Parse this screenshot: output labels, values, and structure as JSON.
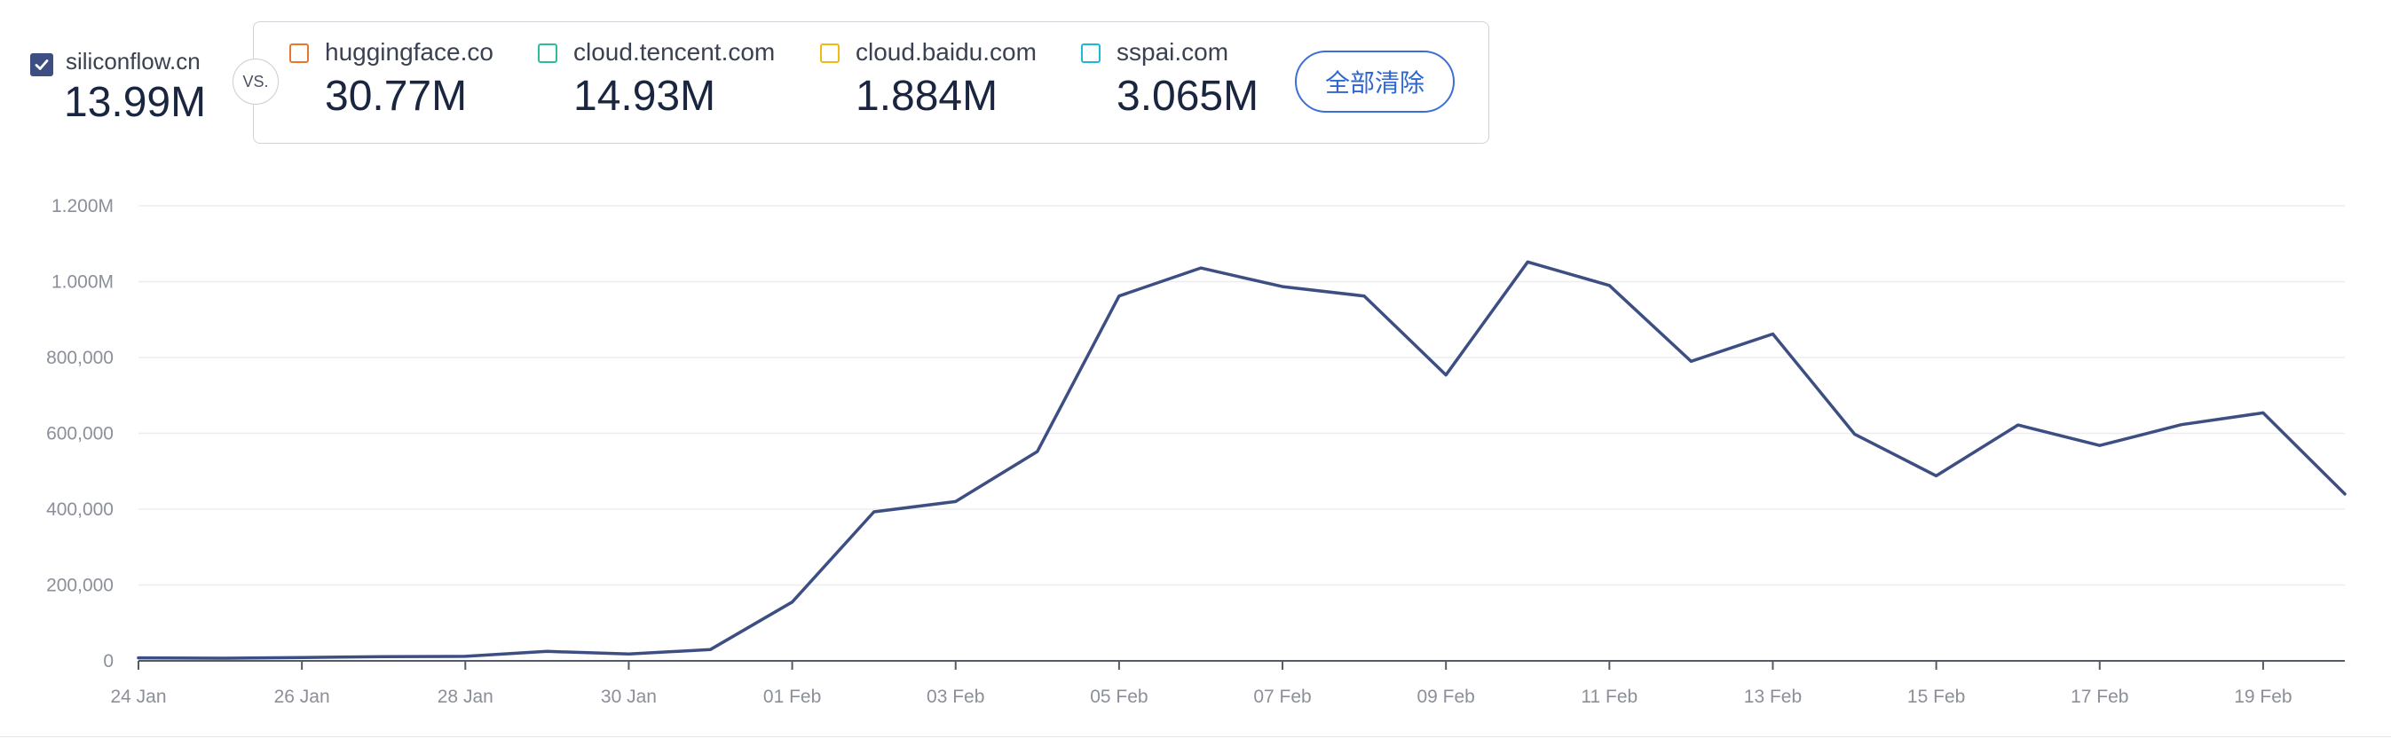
{
  "primary": {
    "domain": "siliconflow.cn",
    "value": "13.99M",
    "checked": true
  },
  "vs_label": "VS.",
  "competitors": [
    {
      "domain": "huggingface.co",
      "value": "30.77M",
      "color": "#e8762d"
    },
    {
      "domain": "cloud.tencent.com",
      "value": "14.93M",
      "color": "#2dbb9a"
    },
    {
      "domain": "cloud.baidu.com",
      "value": "1.884M",
      "color": "#f2b90f"
    },
    {
      "domain": "sspai.com",
      "value": "3.065M",
      "color": "#1cb8d6"
    }
  ],
  "clear_all_label": "全部清除",
  "colors": {
    "line": "#3d4f82",
    "grid": "#ebedf0",
    "axis": "#555b66",
    "tick_text": "#8a8f99"
  },
  "chart_data": {
    "type": "line",
    "x_tick_labels": [
      "24 Jan",
      "26 Jan",
      "28 Jan",
      "30 Jan",
      "01 Feb",
      "03 Feb",
      "05 Feb",
      "07 Feb",
      "09 Feb",
      "11 Feb",
      "13 Feb",
      "15 Feb",
      "17 Feb",
      "19 Feb"
    ],
    "y_tick_labels": [
      "0",
      "200,000",
      "400,000",
      "600,000",
      "800,000",
      "1.000M",
      "1.200M"
    ],
    "ylim": [
      0,
      1200000
    ],
    "grid": true,
    "series": [
      {
        "domain": "siliconflow.cn",
        "x": [
          "24 Jan",
          "25 Jan",
          "26 Jan",
          "27 Jan",
          "28 Jan",
          "29 Jan",
          "30 Jan",
          "31 Jan",
          "01 Feb",
          "02 Feb",
          "03 Feb",
          "04 Feb",
          "05 Feb",
          "06 Feb",
          "07 Feb",
          "08 Feb",
          "09 Feb",
          "10 Feb",
          "11 Feb",
          "12 Feb",
          "13 Feb",
          "14 Feb",
          "15 Feb",
          "16 Feb",
          "17 Feb",
          "18 Feb",
          "19 Feb",
          "20 Feb"
        ],
        "values": [
          8000,
          7000,
          9000,
          11000,
          12000,
          25000,
          18000,
          30000,
          155000,
          393000,
          420000,
          552000,
          962000,
          1036000,
          987000,
          962000,
          754000,
          1052000,
          990000,
          790000,
          862000,
          598000,
          488000,
          622000,
          568000,
          623000,
          654000,
          440000
        ]
      }
    ]
  }
}
